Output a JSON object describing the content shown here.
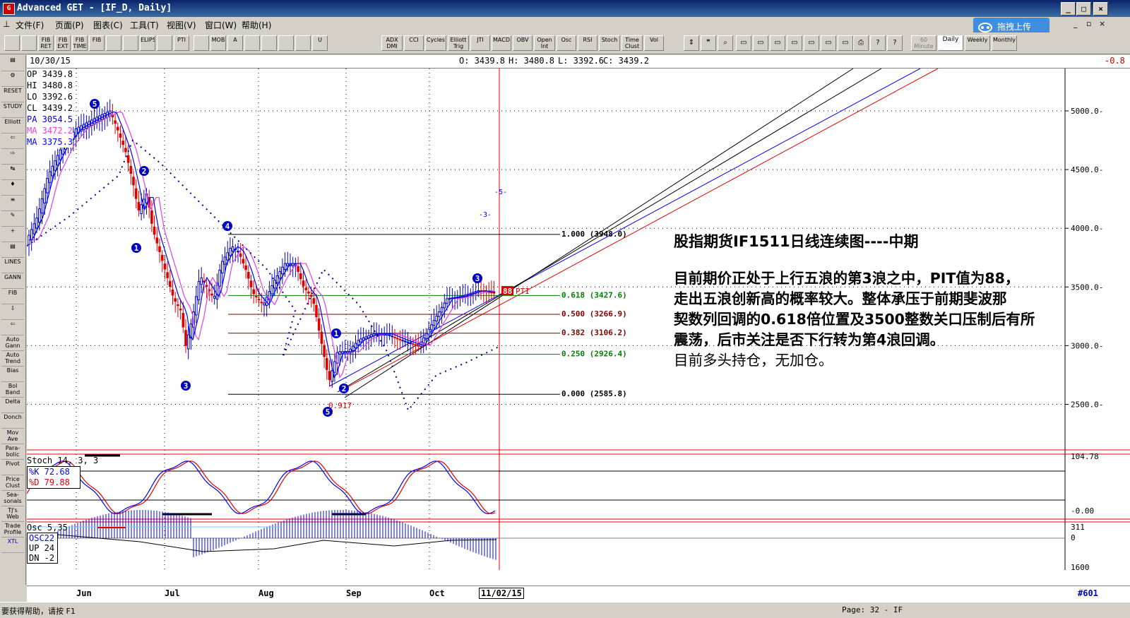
{
  "window": {
    "title": "Advanced GET - [IF_D, Daily]",
    "minimize": "_",
    "maximize": "□",
    "close": "×"
  },
  "menu": {
    "items": [
      "文件(F)",
      "页面(P)",
      "图表(C)",
      "工具(T)",
      "视图(V)",
      "窗口(W)",
      "帮助(H)"
    ]
  },
  "upload_button": "拖拽上传",
  "toolbar": {
    "left": [
      "",
      "",
      "FIB RET",
      "FIB EXT",
      "FIB TIME",
      "FIB",
      "",
      "",
      "ELIPS",
      "",
      "PTI",
      "",
      "MOB",
      "A",
      "",
      "",
      "",
      "",
      "U"
    ],
    "mid": [
      "ADX DMI",
      "CCI",
      "Cycles",
      "Elliott Trig",
      "JTI",
      "MACD",
      "OBV",
      "Open Int",
      "Osc",
      "RSI",
      "Stoch",
      "Time Clust",
      "Vol"
    ],
    "timeframes": [
      "60 Minute",
      "Daily",
      "Weekly",
      "Monthly"
    ]
  },
  "leftbar": [
    "",
    "",
    "RESET",
    "STUDY",
    "Elliott",
    "",
    "",
    "",
    "",
    "",
    "",
    "",
    "",
    "LINES",
    "GANN",
    "FIB",
    "",
    "",
    "Auto Gann",
    "Auto Trend",
    "Bias",
    "Bol Band",
    "Delta",
    "Donch",
    "Mov Ave",
    "Para-bolic",
    "Pivot",
    "Price Clust",
    "Sea-sonals",
    "TJ's Web",
    "Trade Profile",
    "XTL"
  ],
  "infobar": {
    "date": "10/30/15",
    "open": "O: 3439.8",
    "high": "H: 3480.8",
    "low": "L: 3392.6",
    "close": "C: 3439.2",
    "change": "-0.8"
  },
  "ohlc_panel": {
    "op": "OP 3439.8",
    "hi": "HI 3480.8",
    "lo": "LO 3392.6",
    "cl": "CL 3439.2",
    "pa": "PA 3054.5",
    "ma1": "MA 3472.2",
    "ma2": "MA 3375.3"
  },
  "colors": {
    "up_candle": "#0000c8",
    "down_candle": "#e00000",
    "ma_fast": "#e040e0",
    "ma_slow": "#0000ff",
    "fib_red": "#c00000",
    "fib_green": "#008000"
  },
  "price_axis": [
    "5000.0",
    "4500.0",
    "4000.0",
    "3500.0",
    "3000.0",
    "2500.0"
  ],
  "fib_levels": [
    {
      "label": "1.000 (3948.0)",
      "color": "#000000"
    },
    {
      "label": "0.618 (3427.6)",
      "color": "#008000"
    },
    {
      "label": "0.500 (3266.9)",
      "color": "#800000"
    },
    {
      "label": "0.382 (3106.2)",
      "color": "#800000"
    },
    {
      "label": "0.250 (2926.4)",
      "color": "#008000"
    },
    {
      "label": "0.000 (2585.8)",
      "color": "#000000"
    }
  ],
  "pti": {
    "value": "88",
    "label": "PTI"
  },
  "wave_labels": {
    "w5_top": "5",
    "w4": "4",
    "w2a": "2",
    "w1a": "1",
    "w3a": "3",
    "w1b": "1",
    "w2b": "2",
    "w3b": "3",
    "w5_bottom": "5",
    "small_3": "-3-",
    "small_5": "-5-",
    "pt_label": "0.917"
  },
  "annotation": {
    "title": "股指期货IF1511日线连续图----中期",
    "lines": [
      "目前期价正处于上行五浪的第3浪之中，PIT值为88，",
      "走出五浪创新高的概率较大。整体承压于前期斐波那",
      "契数列回调的0.618倍位置及3500整数关口压制后有所",
      "震荡，后市关注是否下行转为第4浪回调。",
      "目前多头持仓，无加仓。"
    ]
  },
  "stoch": {
    "title": "Stoch 14, 3, 3",
    "k": "%K  72.68",
    "d": "%D  79.88",
    "axis_top": "104.78",
    "axis_bottom": "-0.00"
  },
  "osc": {
    "title": "Osc 5,35",
    "osc": "OSC22",
    "up": "UP  24",
    "dn": "DN  -2",
    "axis_top": "311",
    "axis_mid": "0",
    "axis_bottom": "1600"
  },
  "months": [
    "Jun",
    "Jul",
    "Aug",
    "Sep",
    "Oct"
  ],
  "current_date": "11/02/15",
  "bar_count": "#601",
  "status": {
    "help": "要获得帮助，请按 F1",
    "page": "Page: 32 - IF"
  }
}
